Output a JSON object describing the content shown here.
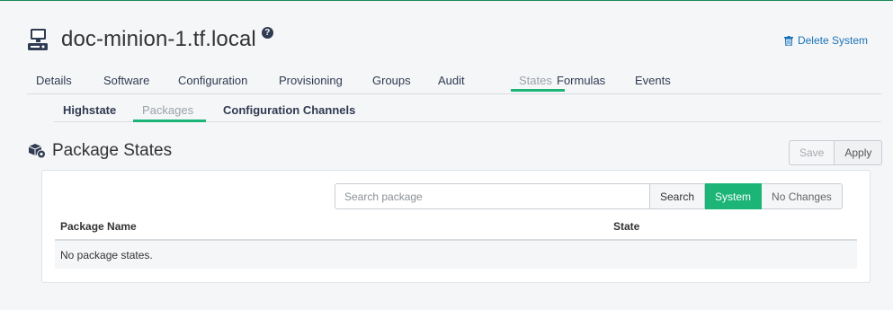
{
  "header": {
    "title": "doc-minion-1.tf.local",
    "help_icon": "question-circle-icon",
    "system_icon": "desktop-system-icon",
    "delete_label": "Delete System",
    "delete_icon": "trash-icon"
  },
  "tabs": [
    {
      "label": "Details"
    },
    {
      "label": "Software"
    },
    {
      "label": "Configuration"
    },
    {
      "label": "Provisioning"
    },
    {
      "label": "Groups"
    },
    {
      "label": "Audit"
    },
    {
      "label": "States",
      "active": true
    },
    {
      "label": "Formulas"
    },
    {
      "label": "Events"
    }
  ],
  "subtabs": [
    {
      "label": "Highstate"
    },
    {
      "label": "Packages",
      "active": true
    },
    {
      "label": "Configuration Channels"
    }
  ],
  "section": {
    "title": "Package States",
    "icon": "packages-gear-icon",
    "save_label": "Save",
    "apply_label": "Apply"
  },
  "search": {
    "placeholder": "Search package",
    "value": "",
    "search_label": "Search",
    "system_label": "System",
    "no_changes_label": "No Changes"
  },
  "table": {
    "columns": [
      "Package Name",
      "State"
    ],
    "empty_message": "No package states."
  },
  "colors": {
    "accent": "#1cb577",
    "nav_text": "#2f3b52",
    "link": "#1a73b8"
  }
}
